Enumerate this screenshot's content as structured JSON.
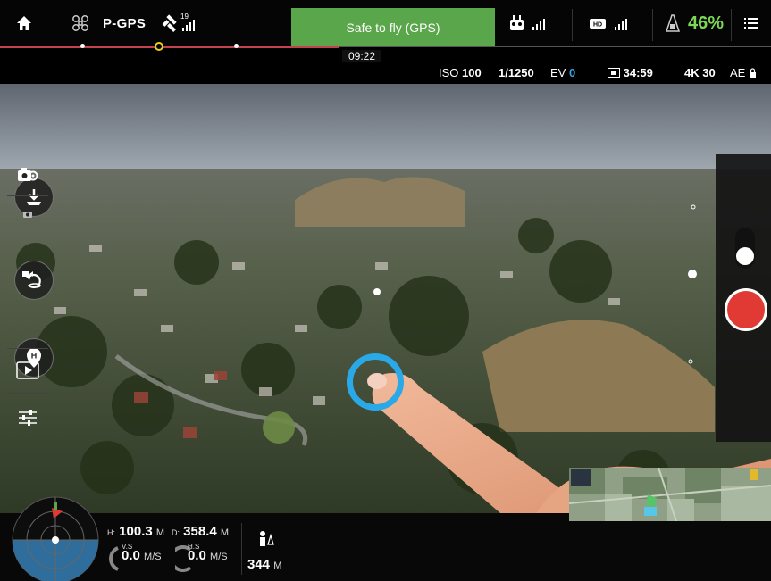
{
  "topbar": {
    "flight_mode": "P-GPS",
    "satellite_count": "19",
    "status_text": "Safe to fly (GPS)",
    "battery_percent": "46%",
    "flight_time": "09:22",
    "status_color": "#5aa64a",
    "battery_color": "#7bd856"
  },
  "camera": {
    "iso_label": "ISO",
    "iso_value": "100",
    "shutter": "1/1250",
    "ev_label": "EV",
    "ev_value": "0",
    "remaining_time": "34:59",
    "resolution": "4K 30",
    "ae_label": "AE"
  },
  "telemetry": {
    "h_label": "H:",
    "height": "100.3",
    "h_unit": "M",
    "d_label": "D:",
    "distance": "358.4",
    "d_unit": "M",
    "vs_label": "V.S",
    "vs_value": "0.0",
    "vs_unit": "M/S",
    "hs_label": "H.S",
    "hs_value": "0.0",
    "hs_unit": "M/S",
    "home_distance": "344",
    "home_unit": "M"
  },
  "colors": {
    "accent_blue": "#2aa9e8",
    "record_red": "#e13a35",
    "timeline_red": "#c2434e"
  },
  "icons": [
    "home-icon",
    "aircraft-icon",
    "satellite-signal-icon",
    "remote-controller-icon",
    "hd-video-signal-icon",
    "battery-icon",
    "menu-icon",
    "takeoff-icon",
    "return-home-icon",
    "home-point-icon",
    "camera-settings-icon",
    "photo-mode-icon",
    "video-mode-icon",
    "playback-icon",
    "sliders-icon"
  ]
}
